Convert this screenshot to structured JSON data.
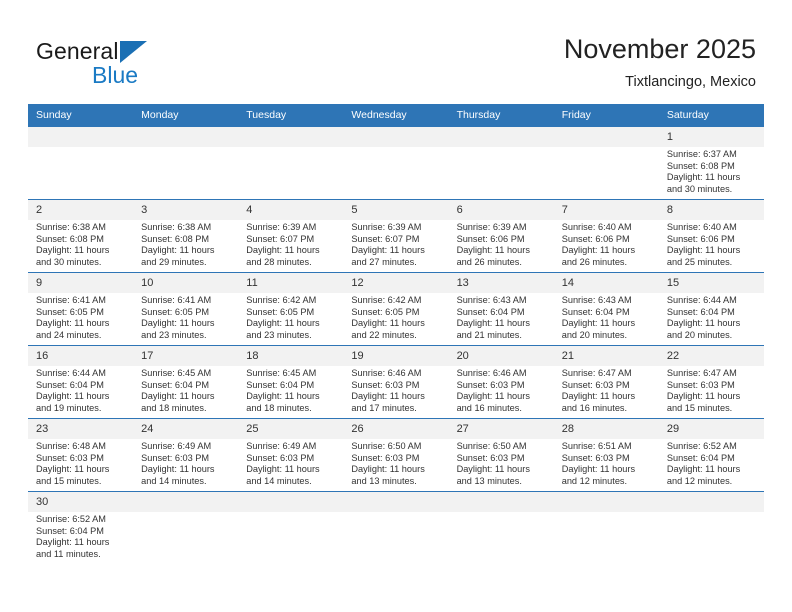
{
  "brand": {
    "name_top": "General",
    "name_bottom": "Blue",
    "triangle_color": "#1a6fb4",
    "blue_text_color": "#1a7ac4"
  },
  "header": {
    "title": "November 2025",
    "subtitle": "Tixtlancingo, Mexico"
  },
  "theme": {
    "header_blue": "#2e75b6",
    "daynum_bg": "#f2f2f2",
    "grid_line": "#2e75b6"
  },
  "weekday_headers": [
    "Sunday",
    "Monday",
    "Tuesday",
    "Wednesday",
    "Thursday",
    "Friday",
    "Saturday"
  ],
  "weeks": [
    [
      {
        "day": "",
        "sunrise": "",
        "sunset": "",
        "daylight": ""
      },
      {
        "day": "",
        "sunrise": "",
        "sunset": "",
        "daylight": ""
      },
      {
        "day": "",
        "sunrise": "",
        "sunset": "",
        "daylight": ""
      },
      {
        "day": "",
        "sunrise": "",
        "sunset": "",
        "daylight": ""
      },
      {
        "day": "",
        "sunrise": "",
        "sunset": "",
        "daylight": ""
      },
      {
        "day": "",
        "sunrise": "",
        "sunset": "",
        "daylight": ""
      },
      {
        "day": "1",
        "sunrise": "Sunrise: 6:37 AM",
        "sunset": "Sunset: 6:08 PM",
        "daylight": "Daylight: 11 hours and 30 minutes."
      }
    ],
    [
      {
        "day": "2",
        "sunrise": "Sunrise: 6:38 AM",
        "sunset": "Sunset: 6:08 PM",
        "daylight": "Daylight: 11 hours and 30 minutes."
      },
      {
        "day": "3",
        "sunrise": "Sunrise: 6:38 AM",
        "sunset": "Sunset: 6:08 PM",
        "daylight": "Daylight: 11 hours and 29 minutes."
      },
      {
        "day": "4",
        "sunrise": "Sunrise: 6:39 AM",
        "sunset": "Sunset: 6:07 PM",
        "daylight": "Daylight: 11 hours and 28 minutes."
      },
      {
        "day": "5",
        "sunrise": "Sunrise: 6:39 AM",
        "sunset": "Sunset: 6:07 PM",
        "daylight": "Daylight: 11 hours and 27 minutes."
      },
      {
        "day": "6",
        "sunrise": "Sunrise: 6:39 AM",
        "sunset": "Sunset: 6:06 PM",
        "daylight": "Daylight: 11 hours and 26 minutes."
      },
      {
        "day": "7",
        "sunrise": "Sunrise: 6:40 AM",
        "sunset": "Sunset: 6:06 PM",
        "daylight": "Daylight: 11 hours and 26 minutes."
      },
      {
        "day": "8",
        "sunrise": "Sunrise: 6:40 AM",
        "sunset": "Sunset: 6:06 PM",
        "daylight": "Daylight: 11 hours and 25 minutes."
      }
    ],
    [
      {
        "day": "9",
        "sunrise": "Sunrise: 6:41 AM",
        "sunset": "Sunset: 6:05 PM",
        "daylight": "Daylight: 11 hours and 24 minutes."
      },
      {
        "day": "10",
        "sunrise": "Sunrise: 6:41 AM",
        "sunset": "Sunset: 6:05 PM",
        "daylight": "Daylight: 11 hours and 23 minutes."
      },
      {
        "day": "11",
        "sunrise": "Sunrise: 6:42 AM",
        "sunset": "Sunset: 6:05 PM",
        "daylight": "Daylight: 11 hours and 23 minutes."
      },
      {
        "day": "12",
        "sunrise": "Sunrise: 6:42 AM",
        "sunset": "Sunset: 6:05 PM",
        "daylight": "Daylight: 11 hours and 22 minutes."
      },
      {
        "day": "13",
        "sunrise": "Sunrise: 6:43 AM",
        "sunset": "Sunset: 6:04 PM",
        "daylight": "Daylight: 11 hours and 21 minutes."
      },
      {
        "day": "14",
        "sunrise": "Sunrise: 6:43 AM",
        "sunset": "Sunset: 6:04 PM",
        "daylight": "Daylight: 11 hours and 20 minutes."
      },
      {
        "day": "15",
        "sunrise": "Sunrise: 6:44 AM",
        "sunset": "Sunset: 6:04 PM",
        "daylight": "Daylight: 11 hours and 20 minutes."
      }
    ],
    [
      {
        "day": "16",
        "sunrise": "Sunrise: 6:44 AM",
        "sunset": "Sunset: 6:04 PM",
        "daylight": "Daylight: 11 hours and 19 minutes."
      },
      {
        "day": "17",
        "sunrise": "Sunrise: 6:45 AM",
        "sunset": "Sunset: 6:04 PM",
        "daylight": "Daylight: 11 hours and 18 minutes."
      },
      {
        "day": "18",
        "sunrise": "Sunrise: 6:45 AM",
        "sunset": "Sunset: 6:04 PM",
        "daylight": "Daylight: 11 hours and 18 minutes."
      },
      {
        "day": "19",
        "sunrise": "Sunrise: 6:46 AM",
        "sunset": "Sunset: 6:03 PM",
        "daylight": "Daylight: 11 hours and 17 minutes."
      },
      {
        "day": "20",
        "sunrise": "Sunrise: 6:46 AM",
        "sunset": "Sunset: 6:03 PM",
        "daylight": "Daylight: 11 hours and 16 minutes."
      },
      {
        "day": "21",
        "sunrise": "Sunrise: 6:47 AM",
        "sunset": "Sunset: 6:03 PM",
        "daylight": "Daylight: 11 hours and 16 minutes."
      },
      {
        "day": "22",
        "sunrise": "Sunrise: 6:47 AM",
        "sunset": "Sunset: 6:03 PM",
        "daylight": "Daylight: 11 hours and 15 minutes."
      }
    ],
    [
      {
        "day": "23",
        "sunrise": "Sunrise: 6:48 AM",
        "sunset": "Sunset: 6:03 PM",
        "daylight": "Daylight: 11 hours and 15 minutes."
      },
      {
        "day": "24",
        "sunrise": "Sunrise: 6:49 AM",
        "sunset": "Sunset: 6:03 PM",
        "daylight": "Daylight: 11 hours and 14 minutes."
      },
      {
        "day": "25",
        "sunrise": "Sunrise: 6:49 AM",
        "sunset": "Sunset: 6:03 PM",
        "daylight": "Daylight: 11 hours and 14 minutes."
      },
      {
        "day": "26",
        "sunrise": "Sunrise: 6:50 AM",
        "sunset": "Sunset: 6:03 PM",
        "daylight": "Daylight: 11 hours and 13 minutes."
      },
      {
        "day": "27",
        "sunrise": "Sunrise: 6:50 AM",
        "sunset": "Sunset: 6:03 PM",
        "daylight": "Daylight: 11 hours and 13 minutes."
      },
      {
        "day": "28",
        "sunrise": "Sunrise: 6:51 AM",
        "sunset": "Sunset: 6:03 PM",
        "daylight": "Daylight: 11 hours and 12 minutes."
      },
      {
        "day": "29",
        "sunrise": "Sunrise: 6:52 AM",
        "sunset": "Sunset: 6:04 PM",
        "daylight": "Daylight: 11 hours and 12 minutes."
      }
    ],
    [
      {
        "day": "30",
        "sunrise": "Sunrise: 6:52 AM",
        "sunset": "Sunset: 6:04 PM",
        "daylight": "Daylight: 11 hours and 11 minutes."
      },
      {
        "day": "",
        "sunrise": "",
        "sunset": "",
        "daylight": ""
      },
      {
        "day": "",
        "sunrise": "",
        "sunset": "",
        "daylight": ""
      },
      {
        "day": "",
        "sunrise": "",
        "sunset": "",
        "daylight": ""
      },
      {
        "day": "",
        "sunrise": "",
        "sunset": "",
        "daylight": ""
      },
      {
        "day": "",
        "sunrise": "",
        "sunset": "",
        "daylight": ""
      },
      {
        "day": "",
        "sunrise": "",
        "sunset": "",
        "daylight": ""
      }
    ]
  ]
}
